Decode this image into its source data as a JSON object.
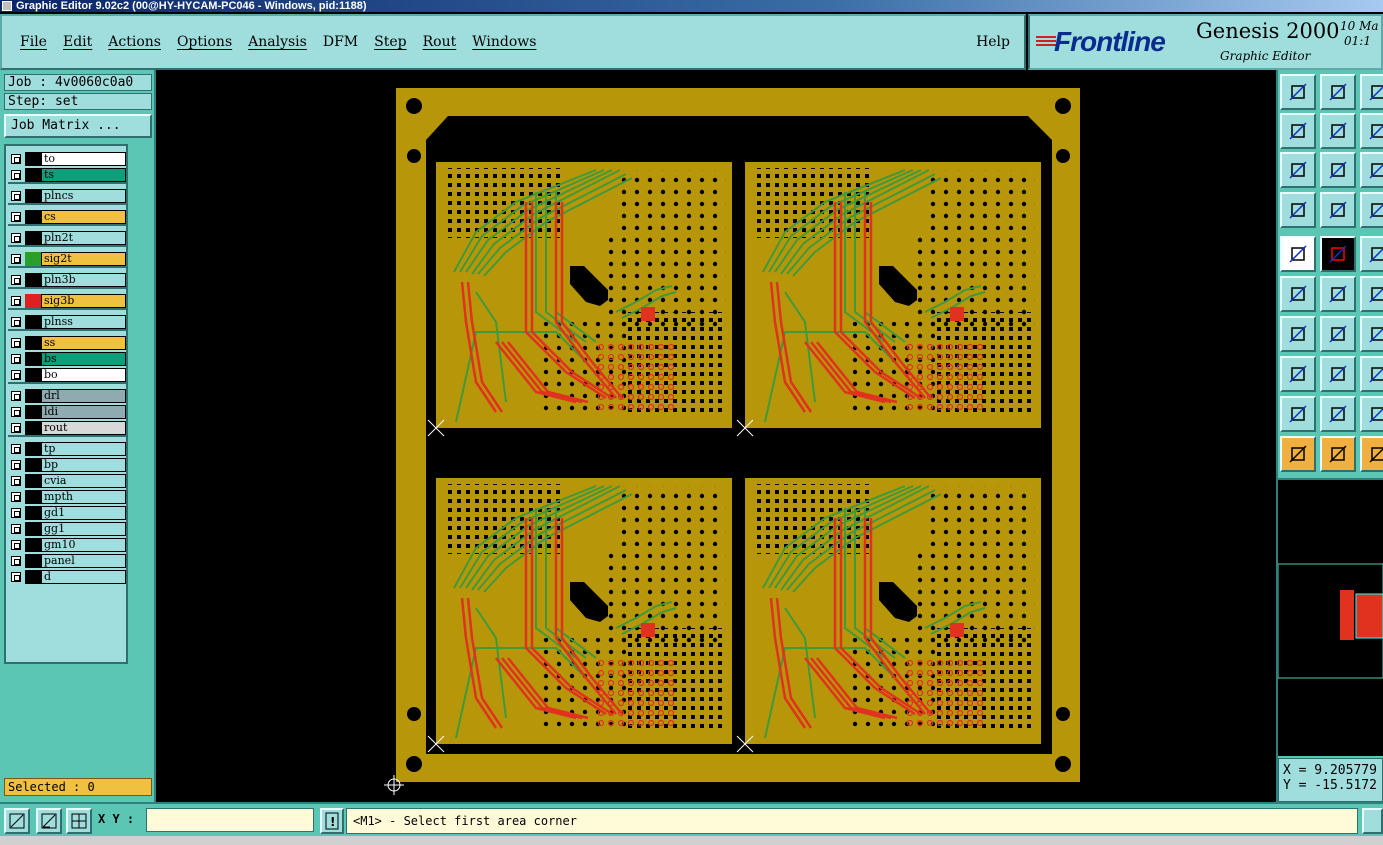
{
  "window": {
    "title": "Graphic Editor 9.02c2 (00@HY-HYCAM-PC046 - Windows, pid:1188)"
  },
  "menu": {
    "items": [
      "File",
      "Edit",
      "Actions",
      "Options",
      "Analysis",
      "DFM",
      "Step",
      "Rout",
      "Windows"
    ],
    "help": "Help"
  },
  "brand": {
    "logo": "Frontline",
    "product": "Genesis 2000",
    "subtitle": "Graphic Editor",
    "date_line1": "10 Ma",
    "date_line2": "01:1"
  },
  "job": {
    "job_label": "Job : 4v0060c0a0",
    "step_label": "Step: set",
    "matrix_button": "Job Matrix ..."
  },
  "layers": [
    {
      "name": "to",
      "color": "#ffffff",
      "swatch": "#000000"
    },
    {
      "name": "ts",
      "color": "#0e9e7a",
      "swatch": "#000000"
    },
    {
      "name": "plncs",
      "color": "#a0dede",
      "swatch": "#000000"
    },
    {
      "name": "cs",
      "color": "#f0c040",
      "swatch": "#000000"
    },
    {
      "name": "pln2t",
      "color": "#a0dede",
      "swatch": "#000000"
    },
    {
      "name": "sig2t",
      "color": "#f0c040",
      "swatch": "#2aa02a"
    },
    {
      "name": "pln3b",
      "color": "#a0dede",
      "swatch": "#000000"
    },
    {
      "name": "sig3b",
      "color": "#f0c040",
      "swatch": "#e02020"
    },
    {
      "name": "plnss",
      "color": "#a0dede",
      "swatch": "#000000"
    },
    {
      "name": "ss",
      "color": "#f0c040",
      "swatch": "#000000"
    },
    {
      "name": "bs",
      "color": "#0e9e7a",
      "swatch": "#000000"
    },
    {
      "name": "bo",
      "color": "#ffffff",
      "swatch": "#000000"
    },
    {
      "name": "drl",
      "color": "#90aab2",
      "swatch": "#000000"
    },
    {
      "name": "ldi",
      "color": "#90aab2",
      "swatch": "#000000"
    },
    {
      "name": "rout",
      "color": "#d8d8d8",
      "swatch": "#000000"
    },
    {
      "name": "tp",
      "color": "#a0dede",
      "swatch": "#000000"
    },
    {
      "name": "bp",
      "color": "#a0dede",
      "swatch": "#000000"
    },
    {
      "name": "cvia",
      "color": "#a0dede",
      "swatch": "#000000"
    },
    {
      "name": "mpth",
      "color": "#a0dede",
      "swatch": "#000000"
    },
    {
      "name": "gd1",
      "color": "#a0dede",
      "swatch": "#000000"
    },
    {
      "name": "gg1",
      "color": "#a0dede",
      "swatch": "#000000"
    },
    {
      "name": "gm10",
      "color": "#a0dede",
      "swatch": "#000000"
    },
    {
      "name": "panel",
      "color": "#a0dede",
      "swatch": "#000000"
    },
    {
      "name": "d",
      "color": "#a0dede",
      "swatch": "#000000"
    }
  ],
  "selected": "Selected : 0",
  "coords": {
    "x": "X = 9.205779",
    "y": "Y = -15.5172"
  },
  "status": {
    "xy_label": "X Y :",
    "xy_value": "",
    "prompt": "<M1> - Select first area corner"
  },
  "colors": {
    "copper": "#b8960a",
    "trace_green": "#3f9a3a",
    "trace_red": "#e0321e",
    "panel_bg": "#000000"
  }
}
